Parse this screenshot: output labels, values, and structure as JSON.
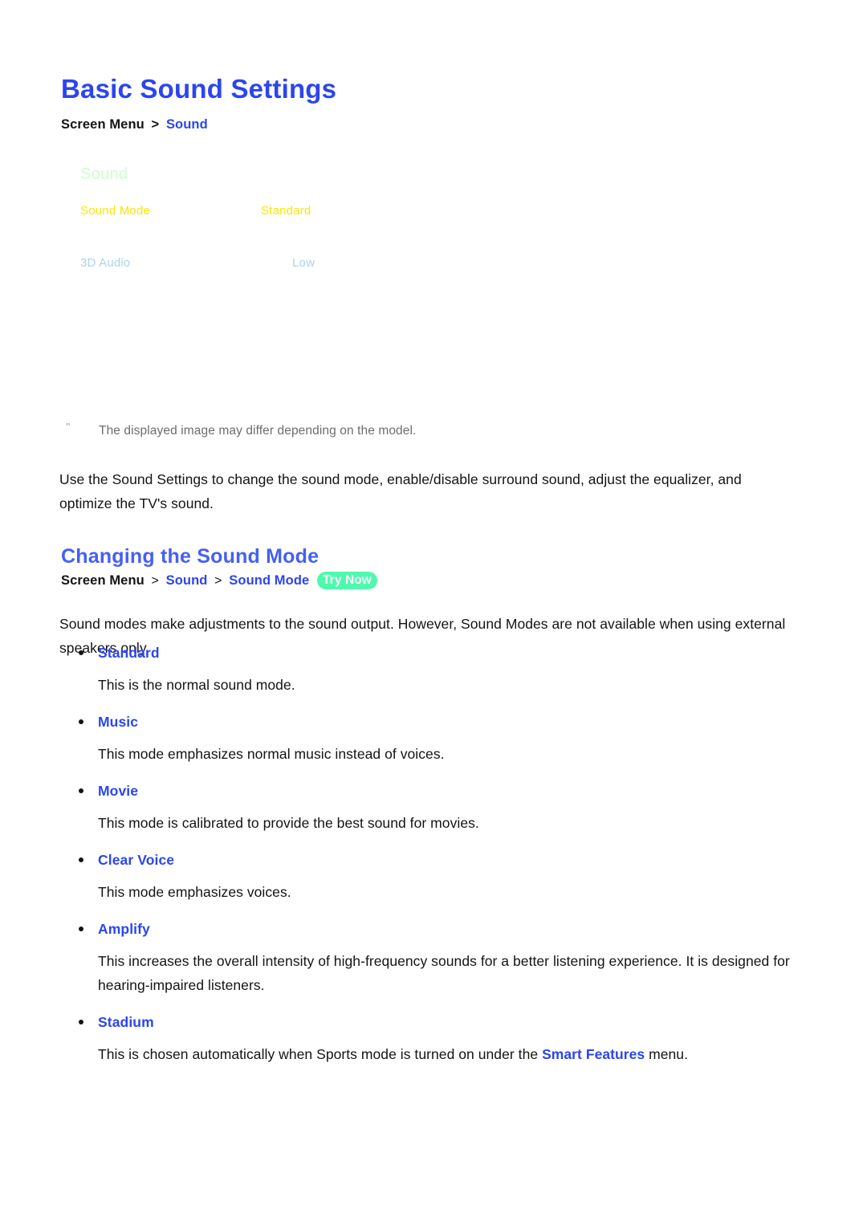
{
  "document": {
    "title": "Basic Sound Settings",
    "section_title": "Changing the Sound Mode"
  },
  "breadcrumb_top": {
    "static": "Screen Menu",
    "separator": ">",
    "link": "Sound"
  },
  "breadcrumb_section": {
    "static": "Screen Menu",
    "separator1": ">",
    "link1": "Sound",
    "separator2": ">",
    "link2": "Sound Mode",
    "badge": "Try Now"
  },
  "tv_menu": {
    "header": "Sound",
    "rows": [
      {
        "label": "Sound Mode",
        "value": "Standard"
      },
      {
        "label": "3D Audio",
        "value": "Low"
      }
    ]
  },
  "note": {
    "mark": "\"",
    "text": "The displayed image may differ depending on the model."
  },
  "paragraphs": {
    "intro": "Use the Sound Settings to change the sound mode, enable/disable surround sound, adjust the equalizer, and optimize the TV's sound.",
    "modes": "Sound modes make adjustments to the sound output. However, Sound Modes are not available when using external speakers only."
  },
  "sound_modes": [
    {
      "name": "Standard",
      "description": "This is the normal sound mode."
    },
    {
      "name": "Music",
      "description": "This mode emphasizes normal music instead of voices."
    },
    {
      "name": "Movie",
      "description": "This mode is calibrated to provide the best sound for movies."
    },
    {
      "name": "Clear Voice",
      "description": "This mode emphasizes voices."
    },
    {
      "name": "Amplify",
      "description": "This increases the overall intensity of high-frequency sounds for a better listening experience. It is designed for hearing-impaired listeners."
    },
    {
      "name": "Stadium",
      "description_before": "This is chosen automatically when Sports mode is turned on under the ",
      "description_link": "Smart Features",
      "description_after": " menu."
    }
  ],
  "colors": {
    "title_blue": "#2b45f0",
    "section_blue": "#4660f2",
    "link_blue": "#2b45f0",
    "badge_green": "#4dfaac",
    "menu_header_green": "#ccffcc",
    "menu_yellow": "#ffe500",
    "menu_blue": "#a9d4e8",
    "note_gray": "#6d6d6d",
    "body_black": "#141414"
  }
}
